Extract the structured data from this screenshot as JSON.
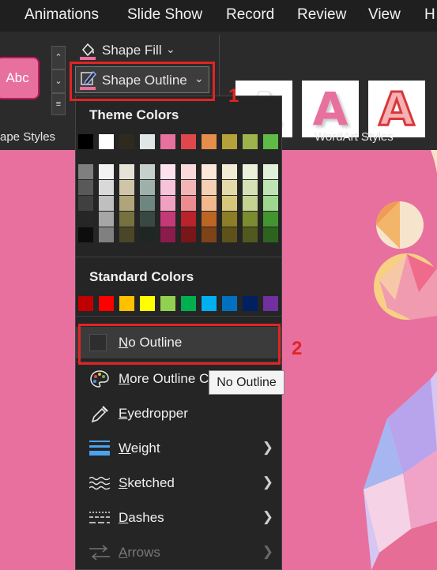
{
  "menubar": {
    "tabs": [
      {
        "label": "Animations"
      },
      {
        "label": "Slide Show"
      },
      {
        "label": "Record"
      },
      {
        "label": "Review"
      },
      {
        "label": "View"
      },
      {
        "label": "H"
      }
    ]
  },
  "ribbon": {
    "shape_style_preview": "Abc",
    "shape_fill_label": "Shape Fill",
    "shape_outline_label": "Shape Outline",
    "shape_styles_group": "ape Styles",
    "wordart_group": "WordArt Styles",
    "wordart_letter": "A"
  },
  "menu": {
    "theme_colors_title": "Theme Colors",
    "standard_colors_title": "Standard Colors",
    "theme_top_row": [
      "#000000",
      "#ffffff",
      "#2f2a1e",
      "#e0e6e5",
      "#e8709e",
      "#e0474c",
      "#e58d4a",
      "#b5a33a",
      "#9fb34d",
      "#5fba46"
    ],
    "theme_shades": [
      [
        "#7f7f7f",
        "#595959",
        "#404040",
        "#262626",
        "#0d0d0d"
      ],
      [
        "#f2f2f2",
        "#d9d9d9",
        "#bfbfbf",
        "#a6a6a6",
        "#808080"
      ],
      [
        "#e6e2d6",
        "#cfc6a9",
        "#b0a47a",
        "#77703f",
        "#4b4628"
      ],
      [
        "#c5d0cc",
        "#9fb0aa",
        "#6f857f",
        "#3a4843",
        "#1f2724"
      ],
      [
        "#fbe2ec",
        "#f6c3d8",
        "#f0a1c2",
        "#c43a78",
        "#8a1b4c"
      ],
      [
        "#f9d9da",
        "#f3b4b6",
        "#ec8c90",
        "#b92329",
        "#7a1519"
      ],
      [
        "#fbe8da",
        "#f6d0b4",
        "#f2b98f",
        "#bd6523",
        "#7e4418"
      ],
      [
        "#f1ecd3",
        "#e4d9a8",
        "#d6c77d",
        "#8c7d26",
        "#5d531a"
      ],
      [
        "#ebf0da",
        "#d7e1b6",
        "#c4d292",
        "#7a8c2f",
        "#51591f"
      ],
      [
        "#dff1d9",
        "#bee4b3",
        "#9fd68d",
        "#42952f",
        "#2c641f"
      ]
    ],
    "standard_colors": [
      "#c00000",
      "#ff0000",
      "#ffc000",
      "#ffff00",
      "#92d050",
      "#00b050",
      "#00b0f0",
      "#0070c0",
      "#002060",
      "#7030a0"
    ],
    "items": [
      {
        "label": "No Outline",
        "accel": "N",
        "rest": "o Outline"
      },
      {
        "label": "More Outline C",
        "accel": "M",
        "rest": "ore Outline C"
      },
      {
        "label": "Eyedropper",
        "accel": "E",
        "rest": "yedropper"
      },
      {
        "label": "Weight",
        "accel": "W",
        "rest": "eight"
      },
      {
        "label": "Sketched",
        "accel": "S",
        "rest": "ketched"
      },
      {
        "label": "Dashes",
        "accel": "D",
        "rest": "ashes"
      },
      {
        "label": "Arrows",
        "accel": "A",
        "rest": "rrows"
      }
    ]
  },
  "tooltip": "No Outline",
  "annotations": {
    "step1": "1",
    "step2": "2"
  },
  "colors": {
    "highlight_red": "#e02424",
    "menu_bg": "#252525",
    "slide_pink": "#e8709e"
  }
}
